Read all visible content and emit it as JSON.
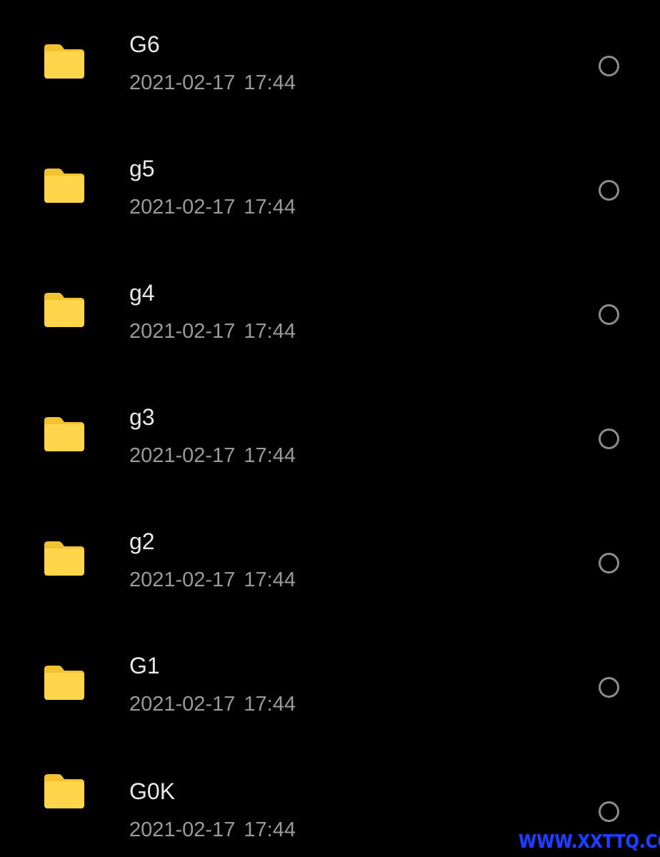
{
  "file_list": {
    "items": [
      {
        "name": "G6",
        "date": "2021-02-17  17:44",
        "icon": "folder-icon",
        "selected": false
      },
      {
        "name": "g5",
        "date": "2021-02-17  17:44",
        "icon": "folder-icon",
        "selected": false
      },
      {
        "name": "g4",
        "date": "2021-02-17  17:44",
        "icon": "folder-icon",
        "selected": false
      },
      {
        "name": "g3",
        "date": "2021-02-17  17:44",
        "icon": "folder-icon",
        "selected": false
      },
      {
        "name": "g2",
        "date": "2021-02-17  17:44",
        "icon": "folder-icon",
        "selected": false
      },
      {
        "name": "G1",
        "date": "2021-02-17  17:44",
        "icon": "folder-icon",
        "selected": false
      },
      {
        "name": "G0K",
        "date": "2021-02-17  17:44",
        "icon": "folder-icon",
        "selected": false
      }
    ]
  },
  "watermark": {
    "text": "WWW.XXTTQ.COM"
  },
  "colors": {
    "background": "#000000",
    "folder": "#FFD54A",
    "folder_tab": "#F2C230",
    "name_text": "#E8E8E8",
    "date_text": "#9A9A9A",
    "radio": "#8C8C8C",
    "watermark": "#1F3CFF"
  }
}
